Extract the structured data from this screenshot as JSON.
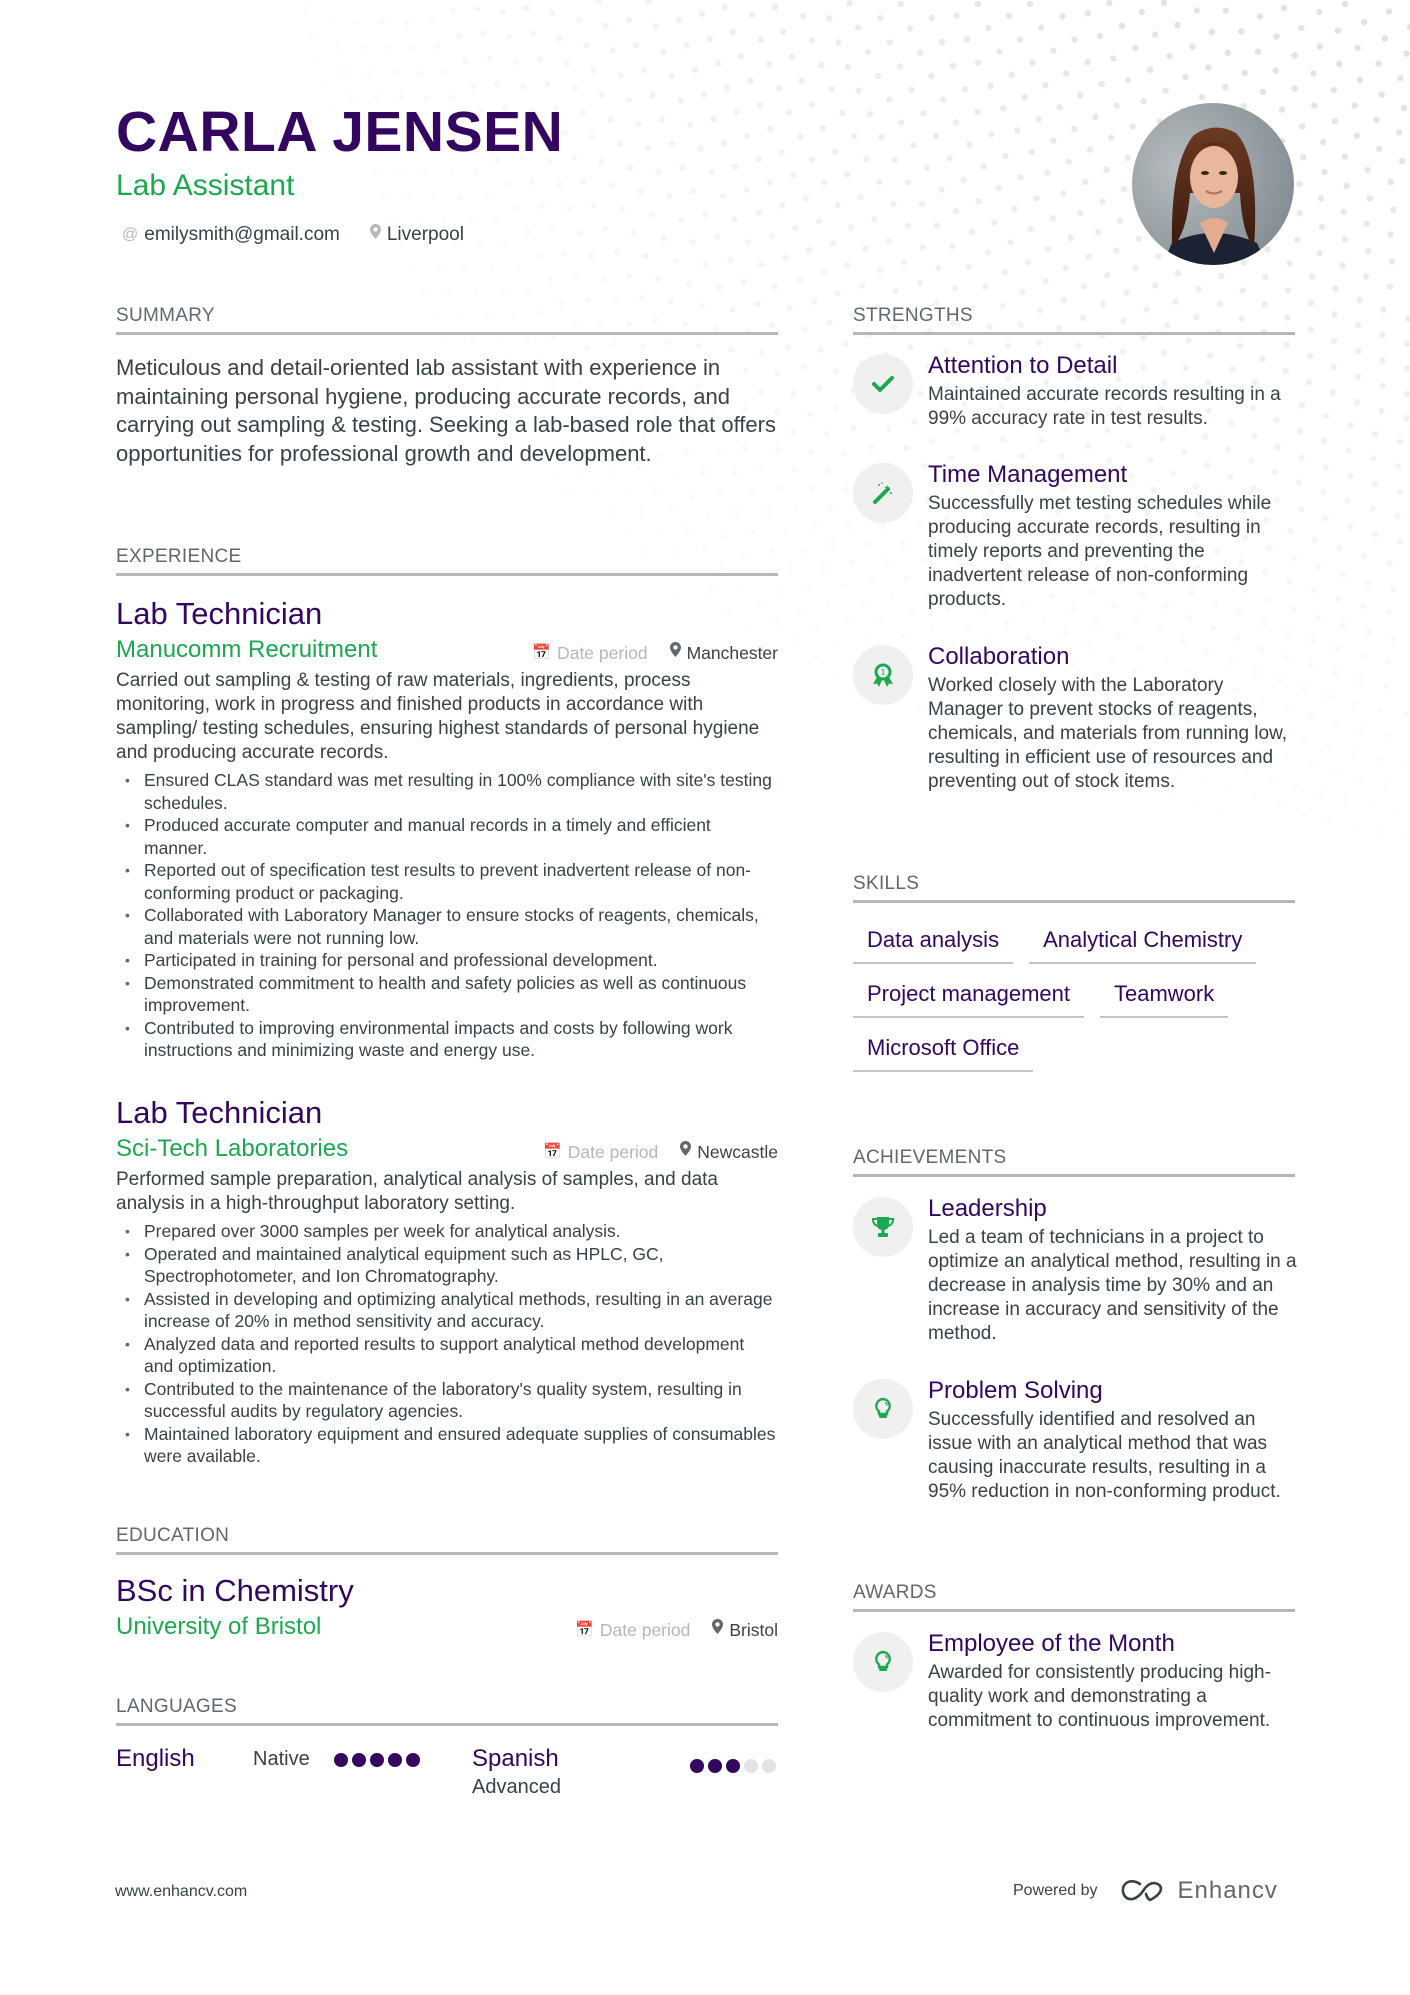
{
  "header": {
    "name": "CARLA JENSEN",
    "role": "Lab Assistant",
    "contacts": [
      {
        "icon": "at-icon",
        "text": "emilysmith@gmail.com"
      },
      {
        "icon": "location-pin-icon",
        "text": "Liverpool"
      }
    ],
    "photo_alt": "Profile photo of Carla Jensen"
  },
  "colors": {
    "primary": "#33065f",
    "accent": "#1ca84f",
    "text": "#384347",
    "muted": "#b4b8bb",
    "divider": "#b5b8ba"
  },
  "summary": {
    "heading": "SUMMARY",
    "text": "Meticulous and detail-oriented lab assistant with experience in maintaining personal hygiene, producing accurate records, and carrying out sampling & testing. Seeking a lab-based role that offers opportunities for professional growth and development."
  },
  "experience": {
    "heading": "EXPERIENCE",
    "jobs": [
      {
        "title": "Lab Technician",
        "company": "Manucomm Recruitment",
        "date": "Date period",
        "location": "Manchester",
        "description": "Carried out sampling & testing of raw materials, ingredients, process monitoring, work in progress and finished products in accordance with sampling/ testing schedules, ensuring highest standards of personal hygiene and producing accurate records.",
        "bullets": [
          "Ensured CLAS standard was met resulting in 100% compliance with site's testing schedules.",
          "Produced accurate computer and manual records in a timely and efficient manner.",
          "Reported out of specification test results to prevent inadvertent release of non-conforming product or packaging.",
          "Collaborated with Laboratory Manager to ensure stocks of reagents, chemicals, and materials were not running low.",
          "Participated in training for personal and professional development.",
          "Demonstrated commitment to health and safety policies as well as continuous improvement.",
          "Contributed to improving environmental impacts and costs by following work instructions and minimizing waste and energy use."
        ]
      },
      {
        "title": "Lab Technician",
        "company": "Sci-Tech Laboratories",
        "date": "Date period",
        "location": "Newcastle",
        "description": "Performed sample preparation, analytical analysis of samples, and data analysis in a high-throughput laboratory setting.",
        "bullets": [
          "Prepared over 3000 samples per week for analytical analysis.",
          "Operated and maintained analytical equipment such as HPLC, GC, Spectrophotometer, and Ion Chromatography.",
          "Assisted in developing and optimizing analytical methods, resulting in an average increase of 20% in method sensitivity and accuracy.",
          "Analyzed data and reported results to support analytical method development and optimization.",
          "Contributed to the maintenance of the laboratory's quality system, resulting in successful audits by regulatory agencies.",
          "Maintained laboratory equipment and ensured adequate supplies of consumables were available."
        ]
      }
    ]
  },
  "education": {
    "heading": "EDUCATION",
    "degree": "BSc in Chemistry",
    "school": "University of Bristol",
    "date": "Date period",
    "location": "Bristol"
  },
  "languages": {
    "heading": "LANGUAGES",
    "items": [
      {
        "name": "English",
        "level": "Native",
        "rating": 5,
        "max": 5
      },
      {
        "name": "Spanish",
        "level": "Advanced",
        "rating": 3,
        "max": 5
      }
    ]
  },
  "strengths": {
    "heading": "STRENGTHS",
    "items": [
      {
        "icon": "checkmark-icon",
        "title": "Attention to Detail",
        "description": "Maintained accurate records resulting in a 99% accuracy rate in test results."
      },
      {
        "icon": "magic-wand-icon",
        "title": "Time Management",
        "description": "Successfully met testing schedules while producing accurate records, resulting in timely reports and preventing the inadvertent release of non-conforming products."
      },
      {
        "icon": "award-ribbon-icon",
        "title": "Collaboration",
        "description": "Worked closely with the Laboratory Manager to prevent stocks of reagents, chemicals, and materials from running low, resulting in efficient use of resources and preventing out of stock items."
      }
    ]
  },
  "skills": {
    "heading": "SKILLS",
    "items": [
      "Data analysis",
      "Analytical Chemistry",
      "Project management",
      "Teamwork",
      "Microsoft Office"
    ]
  },
  "achievements": {
    "heading": "ACHIEVEMENTS",
    "items": [
      {
        "icon": "trophy-icon",
        "title": "Leadership",
        "description": "Led a team of technicians in a project to optimize an analytical method, resulting in a decrease in analysis time by 30% and an increase in accuracy and sensitivity of the method."
      },
      {
        "icon": "lightbulb-icon",
        "title": "Problem Solving",
        "description": "Successfully identified and resolved an issue with an analytical method that was causing inaccurate results, resulting in a 95% reduction in non-conforming product."
      }
    ]
  },
  "awards": {
    "heading": "AWARDS",
    "items": [
      {
        "icon": "lightbulb-icon",
        "title": "Employee of the Month",
        "description": "Awarded for consistently producing high-quality work and demonstrating a commitment to continuous improvement."
      }
    ]
  },
  "footer": {
    "website": "www.enhancv.com",
    "powered_by": "Powered by",
    "brand": "Enhancv"
  }
}
